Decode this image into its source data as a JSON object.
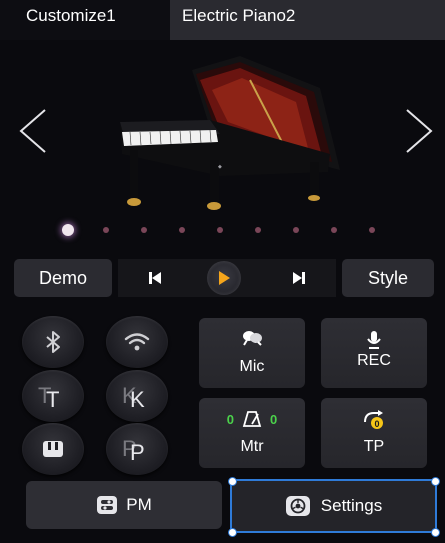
{
  "header": {
    "preset_tab": "Customize1",
    "voice_name": "Electric Piano2"
  },
  "carousel": {
    "prev_icon": "chevron-left-icon",
    "next_icon": "chevron-right-icon",
    "image_subject": "grand-piano",
    "page_count": 9,
    "active_page": 1
  },
  "transport": {
    "demo_label": "Demo",
    "style_label": "Style",
    "prev_icon": "skip-previous-icon",
    "play_icon": "play-icon",
    "next_icon": "skip-next-icon",
    "play_color": "#f5a51b"
  },
  "round_buttons": {
    "bluetooth": "bluetooth-icon",
    "wifi": "wifi-icon",
    "tt_glyph_back": "T",
    "tt_glyph_front": "T",
    "kk_glyph_back": "K",
    "kk_glyph_front": "K",
    "pp_glyph_back": "P",
    "pp_glyph_front": "P",
    "keyboard": "keyboard-icon"
  },
  "tiles": {
    "mic_label": "Mic",
    "rec_label": "REC",
    "mtr_label": "Mtr",
    "mtr_left_value": "0",
    "mtr_right_value": "0",
    "tp_label": "TP",
    "tp_badge": "0"
  },
  "bottom": {
    "pm_label": "PM",
    "settings_label": "Settings"
  },
  "colors": {
    "background": "#0a0a0e",
    "button": "#2b2b31",
    "accent_green": "#4bd14b",
    "selection_outline": "#2f7bd8",
    "active_dot": "#f0e6ee",
    "inactive_dot": "#7a4658"
  }
}
